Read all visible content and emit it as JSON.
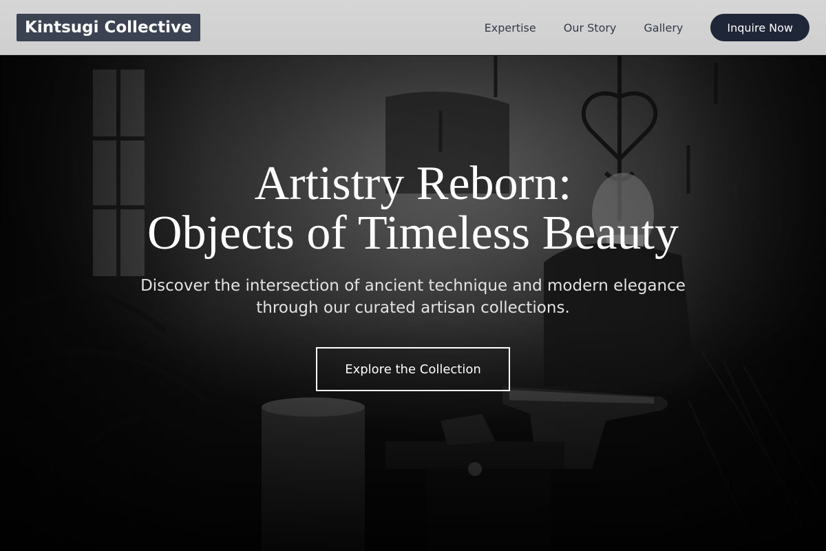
{
  "header": {
    "logo_text": "Kintsugi Collective",
    "nav": [
      {
        "label": "Expertise"
      },
      {
        "label": "Our Story"
      },
      {
        "label": "Gallery"
      }
    ],
    "cta_label": "Inquire Now"
  },
  "hero": {
    "title_line1": "Artistry Reborn:",
    "title_line2": "Objects of Timeless Beauty",
    "subtitle_line1": "Discover the intersection of ancient technique and modern elegance",
    "subtitle_line2": "through our curated artisan collections.",
    "button_label": "Explore the Collection",
    "background_image": "blacksmith-workshop-photo"
  },
  "colors": {
    "header_bg": "#d2d2d2",
    "logo_bg": "#3b4353",
    "cta_bg": "#1f2637",
    "hero_text": "#ffffff"
  }
}
